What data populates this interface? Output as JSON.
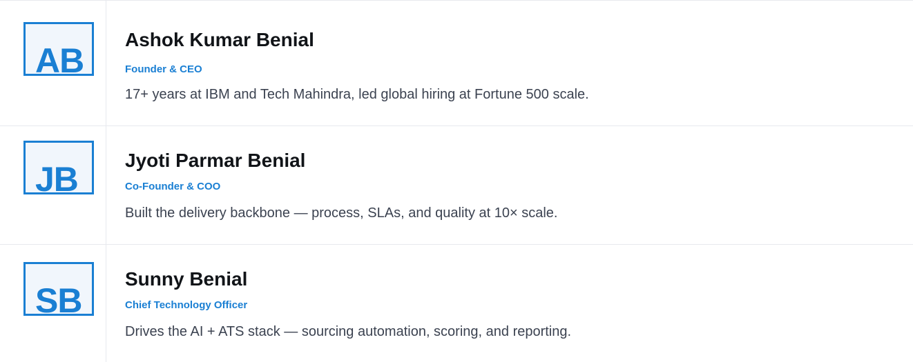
{
  "team": [
    {
      "initials": "AB",
      "name": "Ashok Kumar Benial",
      "role": "Founder & CEO",
      "bio": "17+ years at IBM and Tech Mahindra, led global hiring at Fortune 500 scale."
    },
    {
      "initials": "JB",
      "name": "Jyoti Parmar Benial",
      "role": "Co-Founder & COO",
      "bio": "Built the delivery backbone — process, SLAs, and quality at 10× scale."
    },
    {
      "initials": "SB",
      "name": "Sunny Benial",
      "role": "Chief Technology Officer",
      "bio": "Drives the AI + ATS stack — sourcing automation, scoring, and reporting."
    }
  ],
  "colors": {
    "accent": "#1a7fd3",
    "name_text": "#111418",
    "body_text": "#3b4250",
    "divider": "#e7e9ee",
    "avatar_bg": "#f1f6fc"
  }
}
